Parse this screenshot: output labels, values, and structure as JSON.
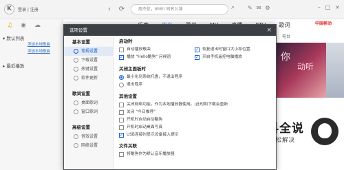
{
  "header": {
    "logo": "K",
    "login_link": "登录 | 注册",
    "search_placeholder": "周杰伦，8MEI 同名公演",
    "nav_back": "‹",
    "nav_refresh": "⟳"
  },
  "content_nav": {
    "tabs": [
      "乐库",
      "电台",
      "歌单",
      "MV",
      "直播",
      "KTV",
      "歌词"
    ],
    "current": "电台",
    "brand": "中国移动"
  },
  "sidebar": {
    "section_default": "▾ 默认列表",
    "items": [
      "添加本地歌曲",
      "添加本地歌曲"
    ],
    "section_recent": "▸ 最近播放"
  },
  "right_panel": {
    "tag": "电台",
    "banner_text_1": "你",
    "banner_text_2": "动听"
  },
  "dialog": {
    "title": "选项设置",
    "close": "×",
    "nav_groups": [
      {
        "title": "基本设置",
        "items": [
          "常规设置",
          "下载设置",
          "热键设置",
          "软件更新"
        ]
      },
      {
        "title": "歌词设置",
        "items": [
          "桌面歌词",
          "窗口歌词"
        ]
      },
      {
        "title": "高级设置",
        "items": [
          "音效设置",
          "网络设置"
        ]
      }
    ],
    "selected_nav": "常规设置",
    "sections": {
      "startup": {
        "title": "启动时",
        "options": [
          {
            "label": "自动播放歌曲",
            "checked": false
          },
          {
            "label": "恢复退出时窗口大小和位置",
            "checked": true
          },
          {
            "label": "播放 \"Hello酷狗\" 问候语",
            "checked": true
          },
          {
            "label": "开启手机遥控电脑播放",
            "checked": true
          }
        ]
      },
      "close_panel": {
        "title": "关闭主面板时",
        "options": [
          {
            "label": "最小化到系统托盘，不退出程序",
            "selected": true
          },
          {
            "label": "退出程序",
            "selected": false
          }
        ]
      },
      "other": {
        "title": "其他设置",
        "options": [
          {
            "label": "关闭网络功能，作为本地播放器使用。(此时和下载会重新",
            "checked": false
          },
          {
            "label": "关闭 \"今日推荐\"",
            "checked": false
          },
          {
            "label": "开机时自动启动酷狗",
            "checked": false
          },
          {
            "label": "开机时启动桌面写真",
            "checked": false
          },
          {
            "label": "USB连接时显示设备接入提示",
            "checked": true
          }
        ]
      },
      "file": {
        "title": "文件关联",
        "options": [
          {
            "label": "将酷狗作为默认音乐播放器",
            "checked": false
          }
        ]
      }
    }
  },
  "watermark": {
    "title": "百科全说",
    "subtitle": "助你轻松解决"
  },
  "colors": {
    "accent": "#1a5fd6",
    "dialog_title_bg": "#3c4045",
    "brand_red": "#e62d2d"
  }
}
